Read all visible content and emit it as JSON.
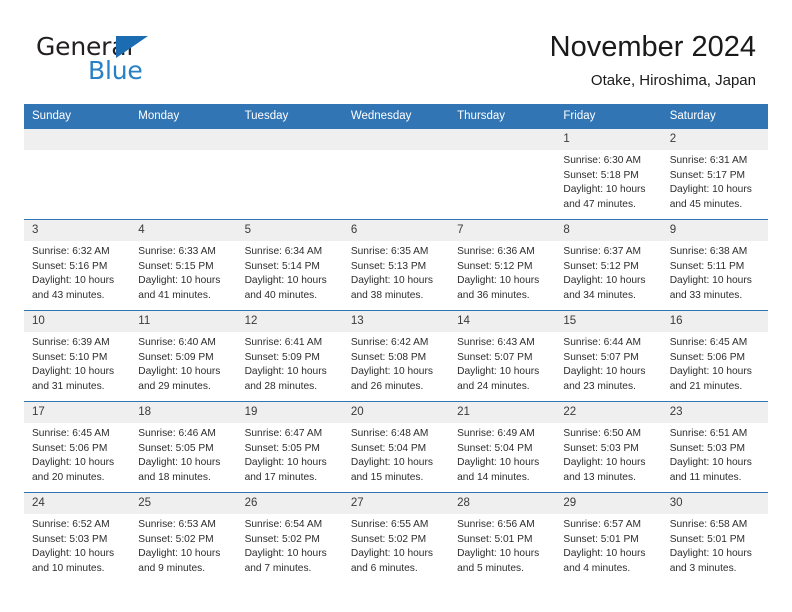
{
  "brand": {
    "name_primary": "General",
    "name_secondary": "Blue",
    "triangle_color": "#1b6cb0",
    "primary_color": "#231f20",
    "secondary_color": "#2980c4"
  },
  "header": {
    "title": "November 2024",
    "subtitle": "Otake, Hiroshima, Japan"
  },
  "theme": {
    "header_blue": "#3275b5",
    "daynum_band": "#efefef",
    "text": "#2d2d2d"
  },
  "weekday_headers": [
    "Sunday",
    "Monday",
    "Tuesday",
    "Wednesday",
    "Thursday",
    "Friday",
    "Saturday"
  ],
  "labels": {
    "sunrise_prefix": "Sunrise:",
    "sunset_prefix": "Sunset:",
    "daylight_prefix": "Daylight:"
  },
  "weeks": [
    [
      {
        "day": "",
        "empty": true,
        "lines": []
      },
      {
        "day": "",
        "empty": true,
        "lines": []
      },
      {
        "day": "",
        "empty": true,
        "lines": []
      },
      {
        "day": "",
        "empty": true,
        "lines": []
      },
      {
        "day": "",
        "empty": true,
        "lines": []
      },
      {
        "day": "1",
        "empty": false,
        "sunrise": "6:30 AM",
        "sunset": "5:18 PM",
        "daylight": "10 hours and 47 minutes.",
        "lines": [
          "Sunrise: 6:30 AM",
          "Sunset: 5:18 PM",
          "Daylight: 10 hours",
          "and 47 minutes."
        ]
      },
      {
        "day": "2",
        "empty": false,
        "sunrise": "6:31 AM",
        "sunset": "5:17 PM",
        "daylight": "10 hours and 45 minutes.",
        "lines": [
          "Sunrise: 6:31 AM",
          "Sunset: 5:17 PM",
          "Daylight: 10 hours",
          "and 45 minutes."
        ]
      }
    ],
    [
      {
        "day": "3",
        "empty": false,
        "sunrise": "6:32 AM",
        "sunset": "5:16 PM",
        "daylight": "10 hours and 43 minutes.",
        "lines": [
          "Sunrise: 6:32 AM",
          "Sunset: 5:16 PM",
          "Daylight: 10 hours",
          "and 43 minutes."
        ]
      },
      {
        "day": "4",
        "empty": false,
        "sunrise": "6:33 AM",
        "sunset": "5:15 PM",
        "daylight": "10 hours and 41 minutes.",
        "lines": [
          "Sunrise: 6:33 AM",
          "Sunset: 5:15 PM",
          "Daylight: 10 hours",
          "and 41 minutes."
        ]
      },
      {
        "day": "5",
        "empty": false,
        "sunrise": "6:34 AM",
        "sunset": "5:14 PM",
        "daylight": "10 hours and 40 minutes.",
        "lines": [
          "Sunrise: 6:34 AM",
          "Sunset: 5:14 PM",
          "Daylight: 10 hours",
          "and 40 minutes."
        ]
      },
      {
        "day": "6",
        "empty": false,
        "sunrise": "6:35 AM",
        "sunset": "5:13 PM",
        "daylight": "10 hours and 38 minutes.",
        "lines": [
          "Sunrise: 6:35 AM",
          "Sunset: 5:13 PM",
          "Daylight: 10 hours",
          "and 38 minutes."
        ]
      },
      {
        "day": "7",
        "empty": false,
        "sunrise": "6:36 AM",
        "sunset": "5:12 PM",
        "daylight": "10 hours and 36 minutes.",
        "lines": [
          "Sunrise: 6:36 AM",
          "Sunset: 5:12 PM",
          "Daylight: 10 hours",
          "and 36 minutes."
        ]
      },
      {
        "day": "8",
        "empty": false,
        "sunrise": "6:37 AM",
        "sunset": "5:12 PM",
        "daylight": "10 hours and 34 minutes.",
        "lines": [
          "Sunrise: 6:37 AM",
          "Sunset: 5:12 PM",
          "Daylight: 10 hours",
          "and 34 minutes."
        ]
      },
      {
        "day": "9",
        "empty": false,
        "sunrise": "6:38 AM",
        "sunset": "5:11 PM",
        "daylight": "10 hours and 33 minutes.",
        "lines": [
          "Sunrise: 6:38 AM",
          "Sunset: 5:11 PM",
          "Daylight: 10 hours",
          "and 33 minutes."
        ]
      }
    ],
    [
      {
        "day": "10",
        "empty": false,
        "sunrise": "6:39 AM",
        "sunset": "5:10 PM",
        "daylight": "10 hours and 31 minutes.",
        "lines": [
          "Sunrise: 6:39 AM",
          "Sunset: 5:10 PM",
          "Daylight: 10 hours",
          "and 31 minutes."
        ]
      },
      {
        "day": "11",
        "empty": false,
        "sunrise": "6:40 AM",
        "sunset": "5:09 PM",
        "daylight": "10 hours and 29 minutes.",
        "lines": [
          "Sunrise: 6:40 AM",
          "Sunset: 5:09 PM",
          "Daylight: 10 hours",
          "and 29 minutes."
        ]
      },
      {
        "day": "12",
        "empty": false,
        "sunrise": "6:41 AM",
        "sunset": "5:09 PM",
        "daylight": "10 hours and 28 minutes.",
        "lines": [
          "Sunrise: 6:41 AM",
          "Sunset: 5:09 PM",
          "Daylight: 10 hours",
          "and 28 minutes."
        ]
      },
      {
        "day": "13",
        "empty": false,
        "sunrise": "6:42 AM",
        "sunset": "5:08 PM",
        "daylight": "10 hours and 26 minutes.",
        "lines": [
          "Sunrise: 6:42 AM",
          "Sunset: 5:08 PM",
          "Daylight: 10 hours",
          "and 26 minutes."
        ]
      },
      {
        "day": "14",
        "empty": false,
        "sunrise": "6:43 AM",
        "sunset": "5:07 PM",
        "daylight": "10 hours and 24 minutes.",
        "lines": [
          "Sunrise: 6:43 AM",
          "Sunset: 5:07 PM",
          "Daylight: 10 hours",
          "and 24 minutes."
        ]
      },
      {
        "day": "15",
        "empty": false,
        "sunrise": "6:44 AM",
        "sunset": "5:07 PM",
        "daylight": "10 hours and 23 minutes.",
        "lines": [
          "Sunrise: 6:44 AM",
          "Sunset: 5:07 PM",
          "Daylight: 10 hours",
          "and 23 minutes."
        ]
      },
      {
        "day": "16",
        "empty": false,
        "sunrise": "6:45 AM",
        "sunset": "5:06 PM",
        "daylight": "10 hours and 21 minutes.",
        "lines": [
          "Sunrise: 6:45 AM",
          "Sunset: 5:06 PM",
          "Daylight: 10 hours",
          "and 21 minutes."
        ]
      }
    ],
    [
      {
        "day": "17",
        "empty": false,
        "sunrise": "6:45 AM",
        "sunset": "5:06 PM",
        "daylight": "10 hours and 20 minutes.",
        "lines": [
          "Sunrise: 6:45 AM",
          "Sunset: 5:06 PM",
          "Daylight: 10 hours",
          "and 20 minutes."
        ]
      },
      {
        "day": "18",
        "empty": false,
        "sunrise": "6:46 AM",
        "sunset": "5:05 PM",
        "daylight": "10 hours and 18 minutes.",
        "lines": [
          "Sunrise: 6:46 AM",
          "Sunset: 5:05 PM",
          "Daylight: 10 hours",
          "and 18 minutes."
        ]
      },
      {
        "day": "19",
        "empty": false,
        "sunrise": "6:47 AM",
        "sunset": "5:05 PM",
        "daylight": "10 hours and 17 minutes.",
        "lines": [
          "Sunrise: 6:47 AM",
          "Sunset: 5:05 PM",
          "Daylight: 10 hours",
          "and 17 minutes."
        ]
      },
      {
        "day": "20",
        "empty": false,
        "sunrise": "6:48 AM",
        "sunset": "5:04 PM",
        "daylight": "10 hours and 15 minutes.",
        "lines": [
          "Sunrise: 6:48 AM",
          "Sunset: 5:04 PM",
          "Daylight: 10 hours",
          "and 15 minutes."
        ]
      },
      {
        "day": "21",
        "empty": false,
        "sunrise": "6:49 AM",
        "sunset": "5:04 PM",
        "daylight": "10 hours and 14 minutes.",
        "lines": [
          "Sunrise: 6:49 AM",
          "Sunset: 5:04 PM",
          "Daylight: 10 hours",
          "and 14 minutes."
        ]
      },
      {
        "day": "22",
        "empty": false,
        "sunrise": "6:50 AM",
        "sunset": "5:03 PM",
        "daylight": "10 hours and 13 minutes.",
        "lines": [
          "Sunrise: 6:50 AM",
          "Sunset: 5:03 PM",
          "Daylight: 10 hours",
          "and 13 minutes."
        ]
      },
      {
        "day": "23",
        "empty": false,
        "sunrise": "6:51 AM",
        "sunset": "5:03 PM",
        "daylight": "10 hours and 11 minutes.",
        "lines": [
          "Sunrise: 6:51 AM",
          "Sunset: 5:03 PM",
          "Daylight: 10 hours",
          "and 11 minutes."
        ]
      }
    ],
    [
      {
        "day": "24",
        "empty": false,
        "sunrise": "6:52 AM",
        "sunset": "5:03 PM",
        "daylight": "10 hours and 10 minutes.",
        "lines": [
          "Sunrise: 6:52 AM",
          "Sunset: 5:03 PM",
          "Daylight: 10 hours",
          "and 10 minutes."
        ]
      },
      {
        "day": "25",
        "empty": false,
        "sunrise": "6:53 AM",
        "sunset": "5:02 PM",
        "daylight": "10 hours and 9 minutes.",
        "lines": [
          "Sunrise: 6:53 AM",
          "Sunset: 5:02 PM",
          "Daylight: 10 hours",
          "and 9 minutes."
        ]
      },
      {
        "day": "26",
        "empty": false,
        "sunrise": "6:54 AM",
        "sunset": "5:02 PM",
        "daylight": "10 hours and 7 minutes.",
        "lines": [
          "Sunrise: 6:54 AM",
          "Sunset: 5:02 PM",
          "Daylight: 10 hours",
          "and 7 minutes."
        ]
      },
      {
        "day": "27",
        "empty": false,
        "sunrise": "6:55 AM",
        "sunset": "5:02 PM",
        "daylight": "10 hours and 6 minutes.",
        "lines": [
          "Sunrise: 6:55 AM",
          "Sunset: 5:02 PM",
          "Daylight: 10 hours",
          "and 6 minutes."
        ]
      },
      {
        "day": "28",
        "empty": false,
        "sunrise": "6:56 AM",
        "sunset": "5:01 PM",
        "daylight": "10 hours and 5 minutes.",
        "lines": [
          "Sunrise: 6:56 AM",
          "Sunset: 5:01 PM",
          "Daylight: 10 hours",
          "and 5 minutes."
        ]
      },
      {
        "day": "29",
        "empty": false,
        "sunrise": "6:57 AM",
        "sunset": "5:01 PM",
        "daylight": "10 hours and 4 minutes.",
        "lines": [
          "Sunrise: 6:57 AM",
          "Sunset: 5:01 PM",
          "Daylight: 10 hours",
          "and 4 minutes."
        ]
      },
      {
        "day": "30",
        "empty": false,
        "sunrise": "6:58 AM",
        "sunset": "5:01 PM",
        "daylight": "10 hours and 3 minutes.",
        "lines": [
          "Sunrise: 6:58 AM",
          "Sunset: 5:01 PM",
          "Daylight: 10 hours",
          "and 3 minutes."
        ]
      }
    ]
  ]
}
